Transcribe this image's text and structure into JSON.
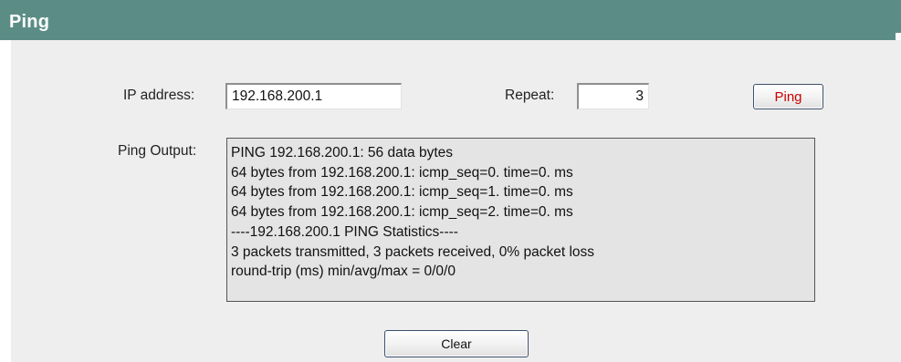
{
  "header": {
    "title": "Ping"
  },
  "form": {
    "ip_label": "IP address:",
    "ip_value": "192.168.200.1",
    "repeat_label": "Repeat:",
    "repeat_value": "3",
    "ping_button": "Ping",
    "output_label": "Ping Output:",
    "clear_button": "Clear"
  },
  "output": {
    "lines": [
      "PING 192.168.200.1: 56 data bytes",
      "64 bytes from 192.168.200.1: icmp_seq=0. time=0. ms",
      "64 bytes from 192.168.200.1: icmp_seq=1. time=0. ms",
      "64 bytes from 192.168.200.1: icmp_seq=2. time=0. ms",
      "----192.168.200.1 PING Statistics----",
      "3 packets transmitted, 3 packets received, 0% packet loss",
      "round-trip (ms) min/avg/max = 0/0/0"
    ]
  },
  "colors": {
    "header_bg": "#5b8d86",
    "panel_bg": "#eeeeee",
    "output_bg": "#e4e4e4",
    "ping_button_text": "#cc0000"
  }
}
